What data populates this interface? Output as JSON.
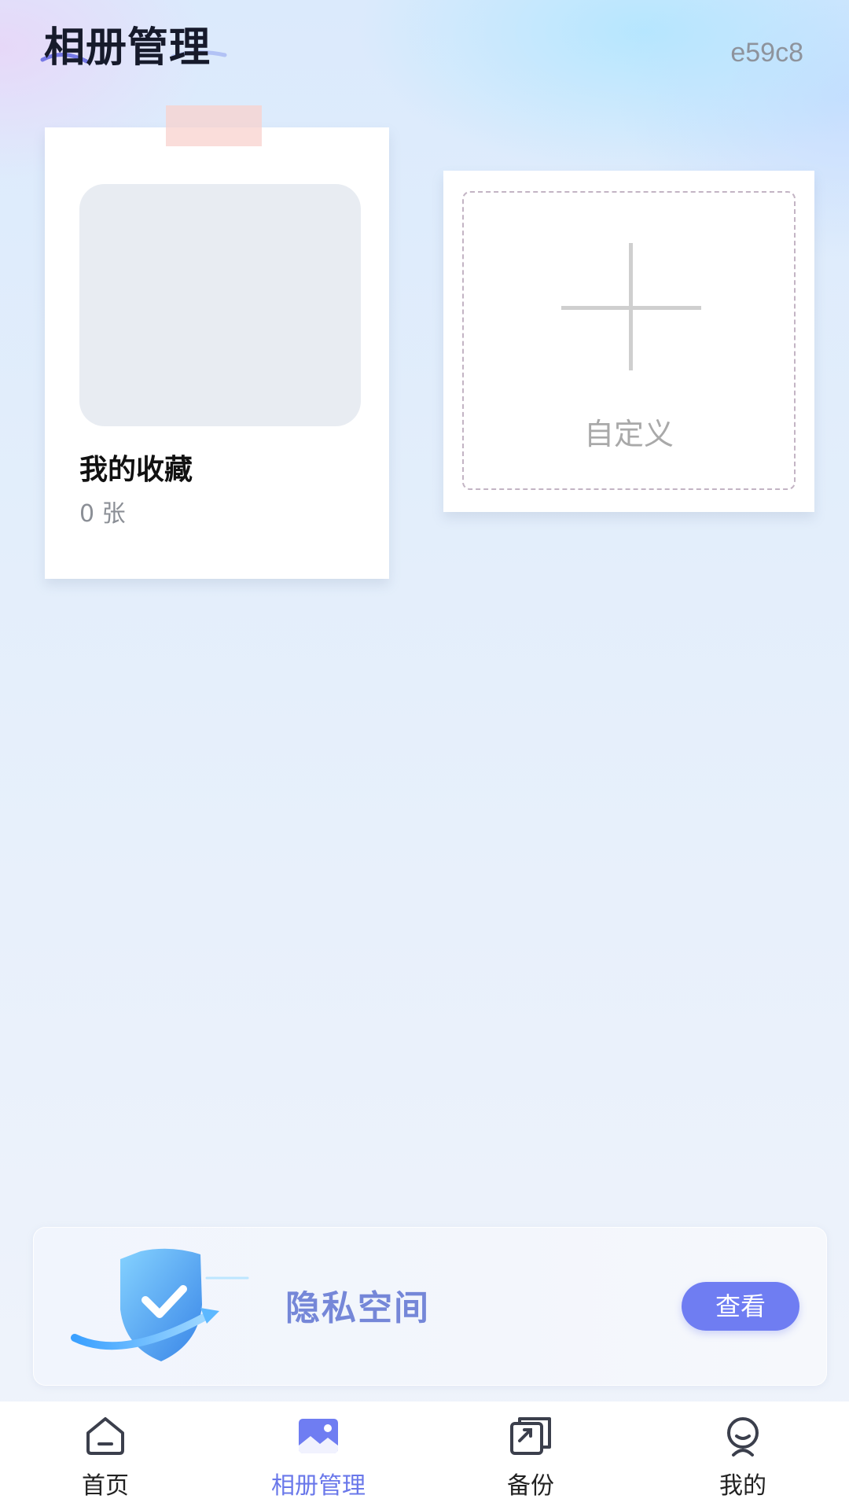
{
  "header": {
    "title": "相册管理",
    "user_id": "e59c8"
  },
  "albums": [
    {
      "name": "我的收藏",
      "count": "0 张"
    }
  ],
  "custom_album": {
    "label": "自定义"
  },
  "privacy": {
    "title": "隐私空间",
    "button_label": "查看"
  },
  "tabbar": {
    "items": [
      {
        "label": "首页",
        "icon": "home-icon"
      },
      {
        "label": "相册管理",
        "icon": "photo-icon"
      },
      {
        "label": "备份",
        "icon": "backup-icon"
      },
      {
        "label": "我的",
        "icon": "profile-icon"
      }
    ],
    "active_index": 1
  },
  "colors": {
    "accent": "#6f7df2",
    "privacy_title": "#7587d8",
    "active_tab": "#6a78ea"
  }
}
